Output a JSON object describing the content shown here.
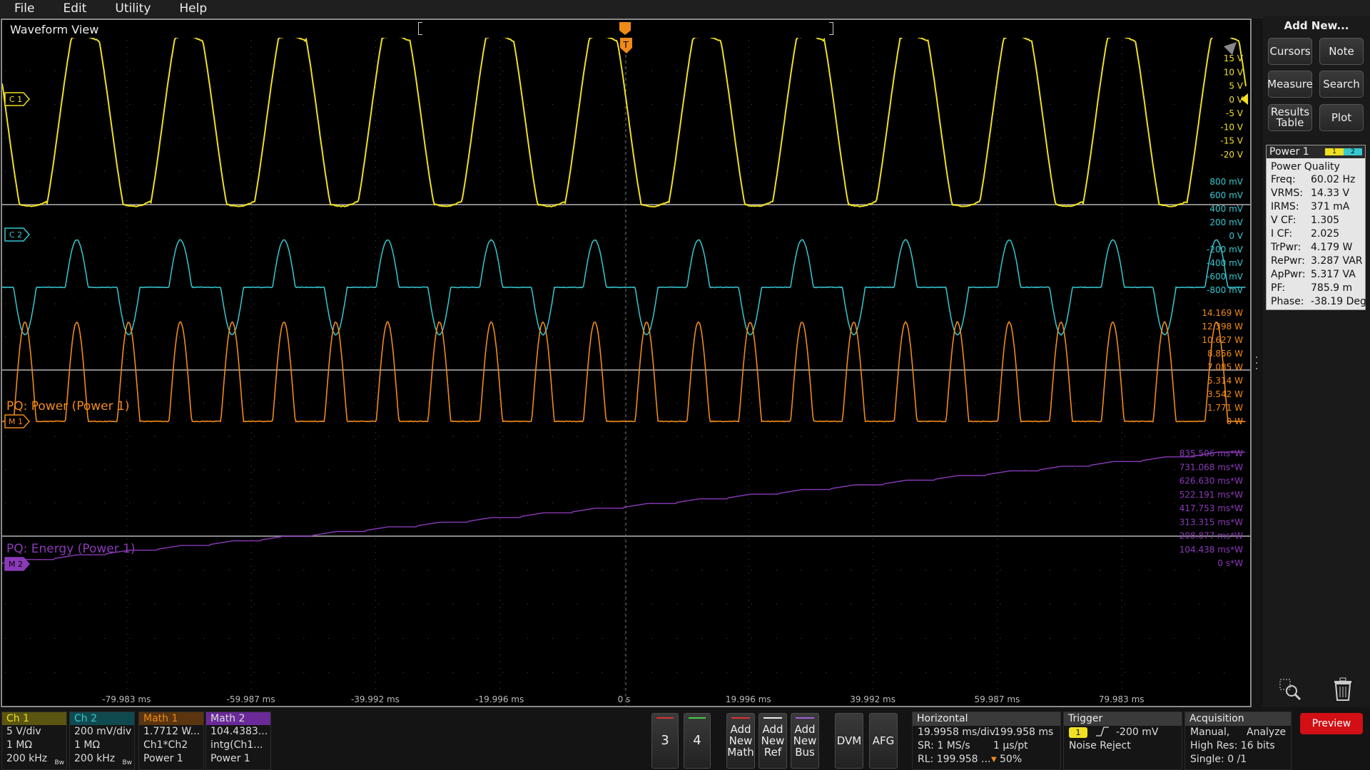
{
  "menu": {
    "items": [
      "File",
      "Edit",
      "Utility",
      "Help"
    ]
  },
  "waveform_view": {
    "title": "Waveform View"
  },
  "channels": {
    "c1": {
      "label": "C 1",
      "color": "#f0e020",
      "scale": [
        "15 V",
        "10 V",
        "5 V",
        "0 V",
        "-5 V",
        "-10 V",
        "-15 V",
        "-20 V"
      ]
    },
    "c2": {
      "label": "C 2",
      "color": "#36c8d0",
      "scale": [
        "800 mV",
        "600 mV",
        "400 mV",
        "200 mV",
        "0 V",
        "-200 mV",
        "-400 mV",
        "-600 mV",
        "-800 mV"
      ]
    },
    "m1": {
      "label": "M 1",
      "color": "#f08a18",
      "name": "PQ: Power (Power 1)",
      "scale": [
        "14.169 W",
        "12.398 W",
        "10.627 W",
        "8.856 W",
        "7.085 W",
        "5.314 W",
        "3.542 W",
        "1.771 W",
        "0 W"
      ]
    },
    "m2": {
      "label": "M 2",
      "color": "#8a3ab8",
      "name": "PQ: Energy (Power 1)",
      "scale": [
        "835.506 ms*W",
        "731.068 ms*W",
        "626.630 ms*W",
        "522.191 ms*W",
        "417.753 ms*W",
        "313.315 ms*W",
        "208.877 ms*W",
        "104.438 ms*W",
        "0 s*W"
      ]
    }
  },
  "time_axis": [
    "-79.983 ms",
    "-59.987 ms",
    "-39.992 ms",
    "-19.996 ms",
    "0 s",
    "19.996 ms",
    "39.992 ms",
    "59.987 ms",
    "79.983 ms"
  ],
  "trigger_marker": "T",
  "add_new": {
    "title": "Add New...",
    "buttons": [
      "Cursors",
      "Note",
      "Measure",
      "Search",
      "Results Table",
      "Plot"
    ]
  },
  "power_quality": {
    "header": "Power 1",
    "badge": [
      "1",
      "2"
    ],
    "type": "Power Quality",
    "rows": [
      {
        "k": "Freq:",
        "v": "60.02 Hz"
      },
      {
        "k": "VRMS:",
        "v": "14.33 V"
      },
      {
        "k": "IRMS:",
        "v": "371 mA"
      },
      {
        "k": "V CF:",
        "v": "1.305"
      },
      {
        "k": "I CF:",
        "v": "2.025"
      },
      {
        "k": "TrPwr:",
        "v": "4.179 W"
      },
      {
        "k": "RePwr:",
        "v": "3.287 VAR"
      },
      {
        "k": "ApPwr:",
        "v": "5.317 VA"
      },
      {
        "k": "PF:",
        "v": "785.9 m"
      },
      {
        "k": "Phase:",
        "v": "-38.19 Deg"
      }
    ]
  },
  "bottom": {
    "ch1": {
      "title": "Ch 1",
      "lines": [
        "5 V/div",
        "1 MΩ",
        "200 kHz"
      ],
      "bw": "Bw",
      "color": "#f0e020",
      "bg": "#5a5510"
    },
    "ch2": {
      "title": "Ch 2",
      "lines": [
        "200 mV/div",
        "1 MΩ",
        "200 kHz"
      ],
      "bw": "Bw",
      "color": "#36c8d0",
      "bg": "#104a50"
    },
    "math1": {
      "title": "Math 1",
      "lines": [
        "1.7712 W...",
        "Ch1*Ch2",
        "Power 1"
      ],
      "color": "#f08a18",
      "bg": "#5a3510"
    },
    "math2": {
      "title": "Math 2",
      "lines": [
        "104.4383...",
        "intg(Ch1...",
        "Power 1"
      ],
      "color": "#ddd",
      "bg": "#6a2a98"
    },
    "ch3": "3",
    "ch4": "4",
    "add_math": "Add New Math",
    "add_ref": "Add New Ref",
    "add_bus": "Add New Bus",
    "dvm": "DVM",
    "afg": "AFG",
    "horizontal": {
      "title": "Horizontal",
      "l1a": "19.9958 ms/div",
      "l1b": "199.958 ms",
      "l2a": "SR: 1 MS/s",
      "l2b": "1 µs/pt",
      "l3a": "RL: 199.958 ...",
      "l3b": "50%"
    },
    "trigger": {
      "title": "Trigger",
      "src": "1",
      "level": "-200 mV",
      "mode": "Noise Reject"
    },
    "acquisition": {
      "title": "Acquisition",
      "l1a": "Manual,",
      "l1b": "Analyze",
      "l2": "High Res: 16 bits",
      "l3": "Single: 0 /1"
    },
    "preview": "Preview"
  }
}
